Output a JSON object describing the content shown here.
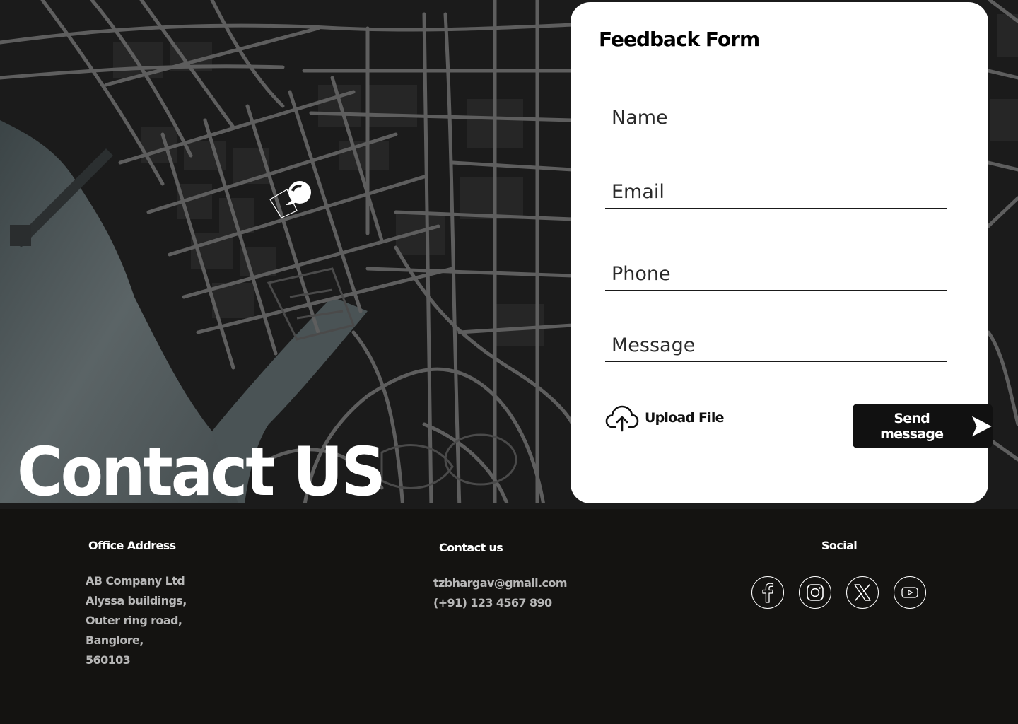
{
  "hero": {
    "title": "Contact US"
  },
  "form": {
    "title": "Feedback Form",
    "fields": {
      "name_placeholder": "Name",
      "email_placeholder": "Email",
      "phone_placeholder": "Phone",
      "message_placeholder": "Message"
    },
    "upload_label": "Upload File",
    "send_label": "Send message"
  },
  "footer": {
    "office": {
      "title": "Office Address",
      "lines": [
        "AB Company Ltd",
        "Alyssa buildings,",
        "Outer ring road,",
        "Banglore,",
        "560103"
      ]
    },
    "contact": {
      "title": "Contact us",
      "email": "tzbhargav@gmail.com",
      "phone": "(+91) 123 4567 890"
    },
    "social": {
      "title": "Social",
      "icons": [
        "facebook-icon",
        "instagram-icon",
        "x-icon",
        "youtube-icon"
      ]
    }
  },
  "colors": {
    "map_background": "#1c1c1c",
    "map_roads": "#5e5e5e",
    "water": "#5b6466",
    "card": "#ffffff",
    "footer": "#141311",
    "button": "#111111",
    "footer_text": "#b7b7b7"
  }
}
